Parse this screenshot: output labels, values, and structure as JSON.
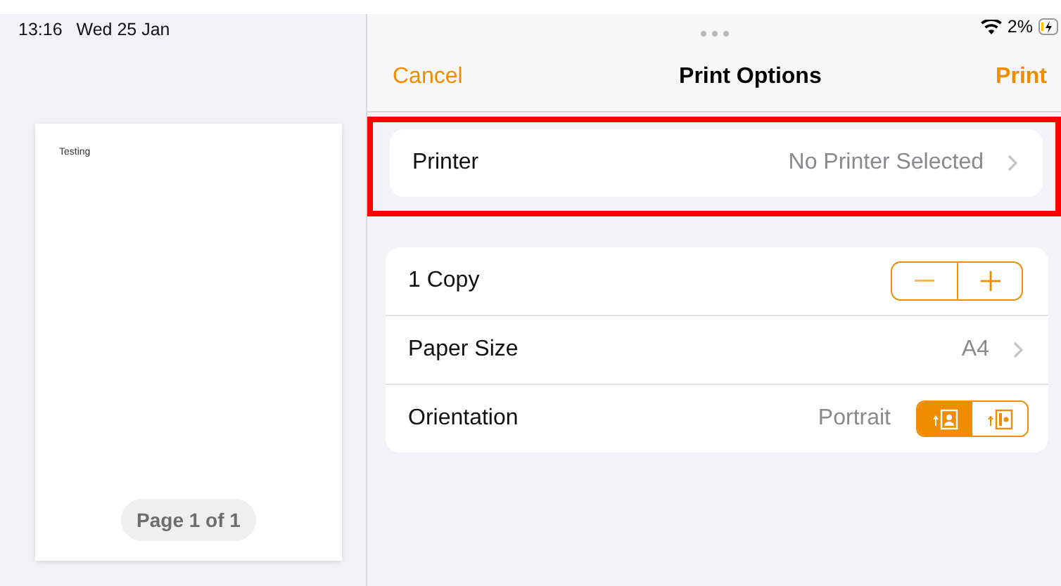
{
  "status_bar": {
    "time": "13:16",
    "date": "Wed 25 Jan",
    "battery": "2%"
  },
  "preview": {
    "page_text": "Testing",
    "page_label": "Page 1 of 1"
  },
  "nav": {
    "cancel": "Cancel",
    "title": "Print Options",
    "action": "Print"
  },
  "printer": {
    "label": "Printer",
    "value": "No Printer Selected",
    "highlighted": true
  },
  "options": [
    {
      "kind": "stepper",
      "label": "1 Copy"
    },
    {
      "kind": "choice",
      "label": "Paper Size",
      "value": "A4"
    },
    {
      "kind": "orientation",
      "label": "Orientation",
      "value": "Portrait",
      "choices": [
        {
          "kind": "portrait",
          "selected": true
        },
        {
          "kind": "landscape",
          "selected": false
        }
      ]
    }
  ]
}
